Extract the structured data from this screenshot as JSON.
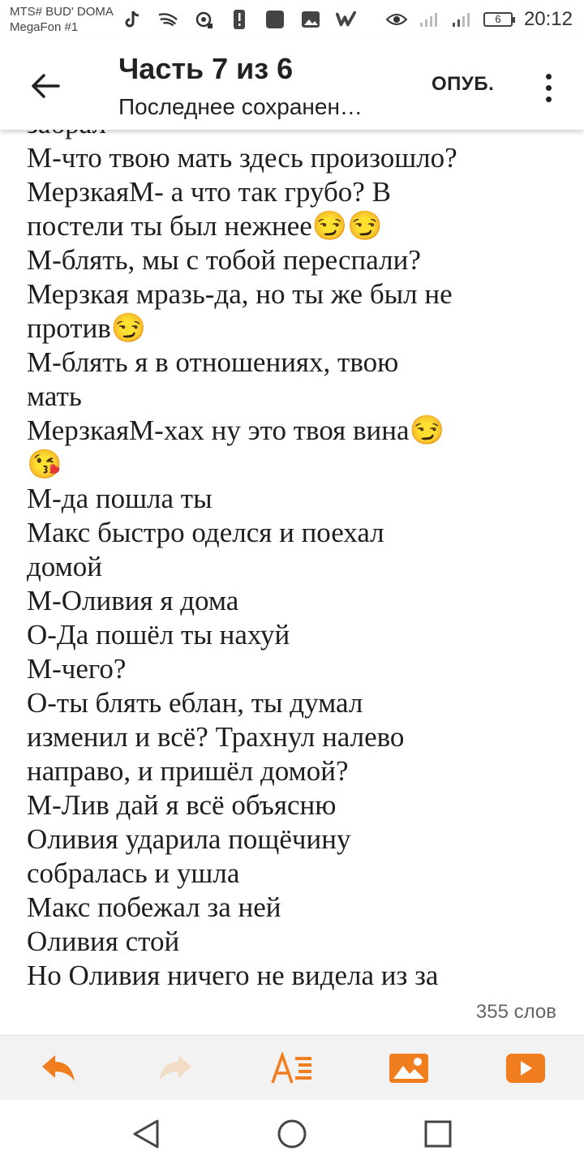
{
  "status_bar": {
    "carrier_line1": "MTS# BUD' DOMA",
    "carrier_line2": "MegaFon #1",
    "battery": "6",
    "time": "20:12",
    "icons": [
      "tiktok-icon",
      "swift-icon",
      "camera-icon",
      "alert-icon",
      "app-icon",
      "image-icon",
      "wattpad-icon",
      "eye-icon",
      "signal-icon",
      "signal-icon"
    ]
  },
  "toolbar": {
    "title": "Часть 7 из 6",
    "subtitle": "Последнее сохранен…",
    "publish": "ОПУБ."
  },
  "editor": {
    "lines": [
      "забрал",
      "М-что твою мать здесь произошло?",
      "МерзкаяМ- а что так грубо? В",
      "постели ты был нежнее😏😏",
      "М-блять, мы с тобой переспали?",
      "Мерзкая мразь-да, но ты же был не",
      "против😏",
      "М-блять я в отношениях, твою",
      "мать",
      "МерзкаяМ-хах ну это твоя вина😏",
      "😘",
      "М-да пошла ты",
      "Макс быстро оделся и поехал",
      "домой",
      "М-Оливия я дома",
      "О-Да пошёл ты нахуй",
      "М-чего?",
      "О-ты блять еблан, ты думал",
      "изменил и всё? Трахнул налево",
      "направо, и пришёл домой?",
      "М-Лив дай я всё объясню",
      "Оливия ударила пощёчину",
      "собралась и ушла",
      "Макс побежал за ней",
      "Оливия стой",
      "Но Оливия ничего не видела из за"
    ],
    "word_count": "355 слов"
  },
  "colors": {
    "accent": "#f07d1e",
    "disabled": "#f3dcc6"
  }
}
